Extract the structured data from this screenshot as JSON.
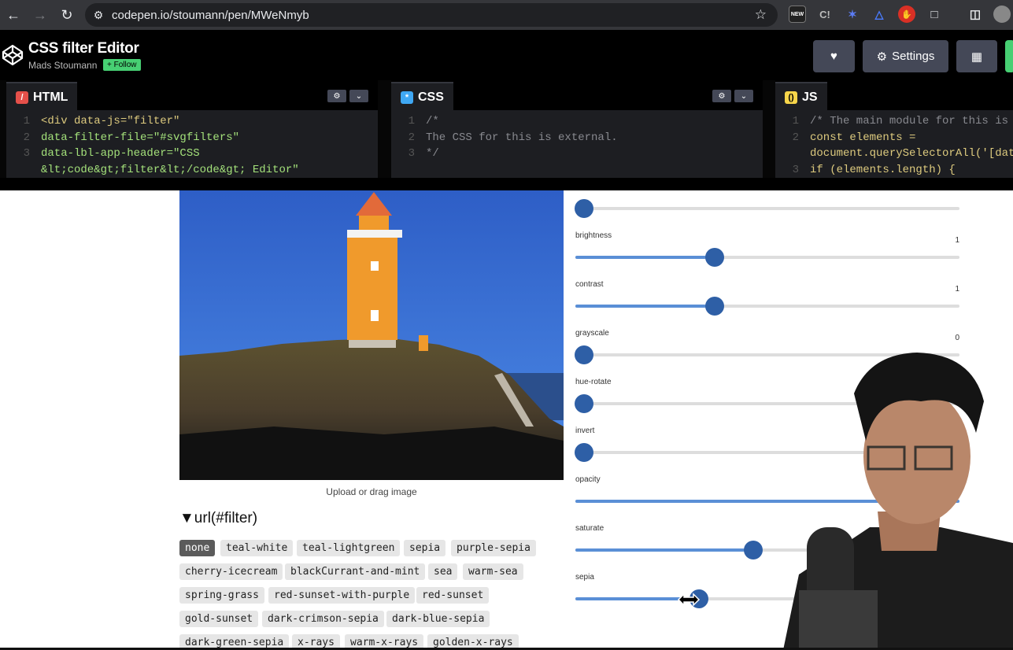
{
  "browser": {
    "url": "codepen.io/stoumann/pen/MWeNmyb",
    "extensions": [
      "NEW",
      "C!"
    ]
  },
  "pen": {
    "title": "CSS filter Editor",
    "author": "Mads Stoumann",
    "follow_label": "+ Follow",
    "settings_label": "Settings"
  },
  "editors": {
    "html": {
      "label": "HTML",
      "lines": [
        {
          "n": "1",
          "t": "<div data-js=\"filter\""
        },
        {
          "n": "2",
          "t": "data-filter-file=\"#svgfilters\""
        },
        {
          "n": "3",
          "t": "data-lbl-app-header=\"CSS"
        },
        {
          "n": "",
          "t": "&lt;code&gt;filter&lt;/code&gt; Editor\""
        }
      ]
    },
    "css": {
      "label": "CSS",
      "lines": [
        {
          "n": "1",
          "t": "/*"
        },
        {
          "n": "2",
          "t": "The CSS for this is external."
        },
        {
          "n": "3",
          "t": "*/"
        }
      ]
    },
    "js": {
      "label": "JS",
      "lines": [
        {
          "n": "1",
          "t": "/* The main module for this is e"
        },
        {
          "n": "2",
          "t": "const elements ="
        },
        {
          "n": "",
          "t": "document.querySelectorAll('[data"
        },
        {
          "n": "3",
          "t": "if (elements.length) {"
        }
      ]
    }
  },
  "preview": {
    "upload_label": "Upload or drag image",
    "filter_summary": "▼url(#filter)",
    "chips": [
      "none",
      "teal-white",
      "teal-lightgreen",
      "sepia",
      "purple-sepia",
      "cherry-icecream",
      "blackCurrant-and-mint",
      "sea",
      "warm-sea",
      "spring-grass",
      "red-sunset-with-purple",
      "red-sunset",
      "gold-sunset",
      "dark-crimson-sepia",
      "dark-blue-sepia",
      "dark-green-sepia",
      "x-rays",
      "warm-x-rays",
      "golden-x-rays"
    ],
    "selected_chip": "none"
  },
  "sliders": [
    {
      "label": "",
      "value": "",
      "level": 0
    },
    {
      "label": "brightness",
      "value": "1",
      "level": 0.34
    },
    {
      "label": "contrast",
      "value": "1",
      "level": 0.34
    },
    {
      "label": "grayscale",
      "value": "0",
      "level": 0
    },
    {
      "label": "hue-rotate",
      "value": "",
      "level": 0
    },
    {
      "label": "invert",
      "value": "",
      "level": 0
    },
    {
      "label": "opacity",
      "value": "",
      "level": 1
    },
    {
      "label": "saturate",
      "value": "",
      "level": 0.44
    },
    {
      "label": "sepia",
      "value": "",
      "level": 0.3
    }
  ],
  "colors": {
    "accent": "#2e5fa6",
    "track_fill": "#5a8fd6",
    "codepen_bg": "#000000",
    "editor_bg": "#1d1e22",
    "follow_green": "#47cf73"
  }
}
